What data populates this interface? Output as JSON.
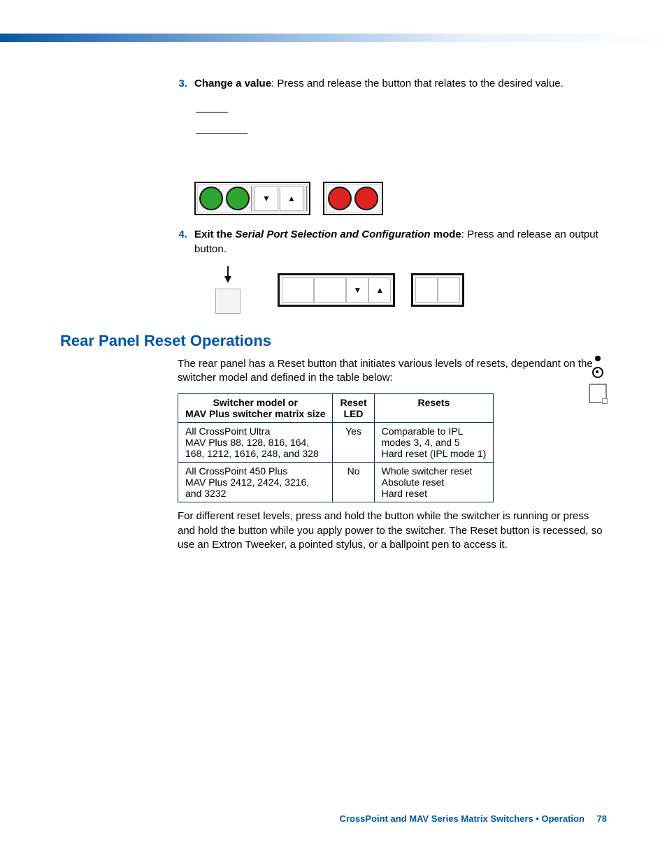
{
  "steps": {
    "s3": {
      "num": "3.",
      "lead_bold": "Change a value",
      "rest": ": Press and release the button that relates to the desired value."
    },
    "s4": {
      "num": "4.",
      "lead_bold": "Exit the ",
      "mode_name": "Serial Port Selection and Configuration",
      "mode_suffix": " mode",
      "rest": ": Press and release an output button."
    }
  },
  "section_title": "Rear Panel Reset Operations",
  "intro": "The rear panel has a Reset button that initiates various levels of resets, dependant on the switcher model and defined in the table below:",
  "table": {
    "headers": {
      "col1_l1": "Switcher model or",
      "col1_l2": "MAV Plus switcher matrix size",
      "col2_l1": "Reset",
      "col2_l2": "LED",
      "col3": "Resets"
    },
    "rows": [
      {
        "model_l1": "All CrossPoint Ultra",
        "model_l2": "MAV Plus 88, 128, 816, 164,",
        "model_l3": "168, 1212, 1616, 248, and 328",
        "led": "Yes",
        "resets_l1": "Comparable to IPL",
        "resets_l2": "modes 3, 4, and 5",
        "resets_l3": "Hard reset (IPL mode 1)"
      },
      {
        "model_l1": "All CrossPoint 450 Plus",
        "model_l2": "MAV Plus 2412, 2424, 3216,",
        "model_l3": "and 3232",
        "led": "No",
        "resets_l1": "Whole switcher reset",
        "resets_l2": "Absolute reset",
        "resets_l3": "Hard reset"
      }
    ]
  },
  "outro": "For different reset levels, press and hold the button while the switcher is running or press and hold the button while you apply power to the switcher. The Reset button is recessed, so use an Extron Tweeker, a pointed stylus, or a ballpoint pen to access it.",
  "footer": {
    "text": "CrossPoint and MAV Series Matrix Switchers • Operation",
    "page": "78"
  }
}
